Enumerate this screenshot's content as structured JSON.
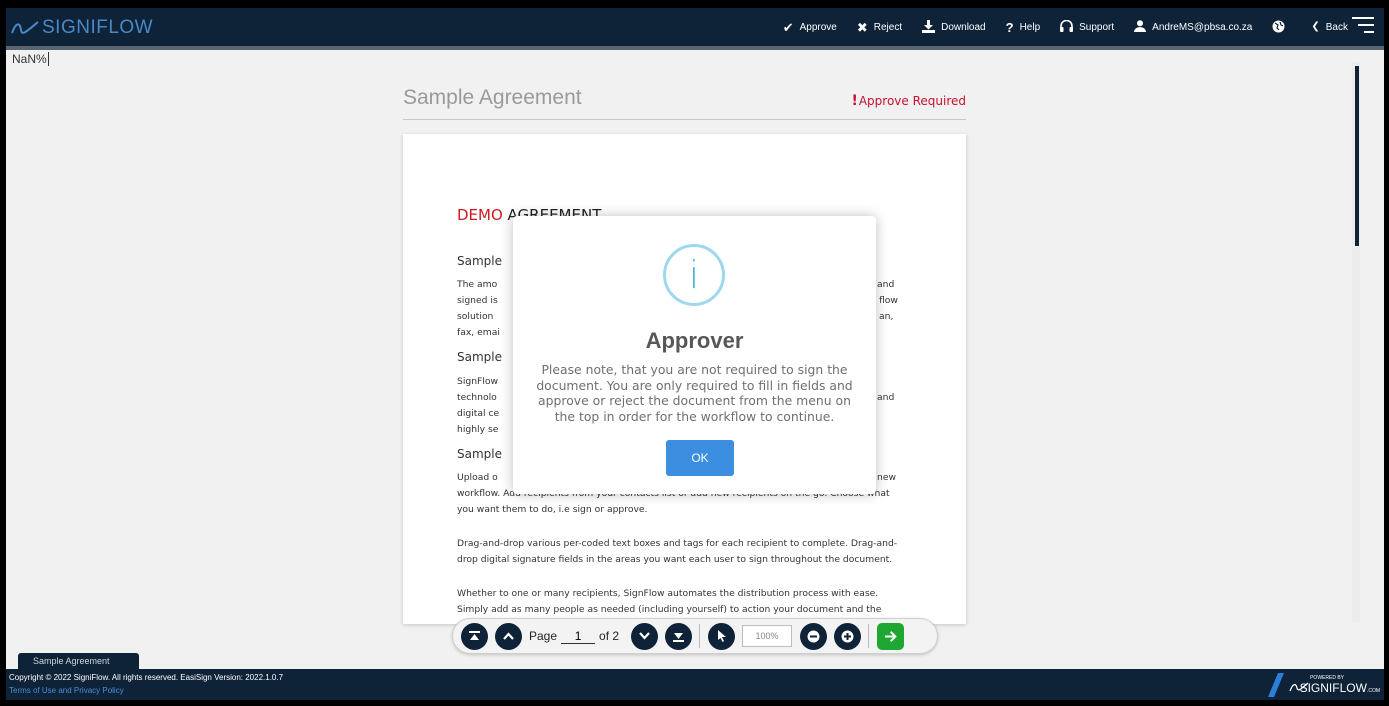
{
  "app": {
    "logo_text": "SIGNIFLOW"
  },
  "topbar": {
    "approve": "Approve",
    "reject": "Reject",
    "download": "Download",
    "help": "Help",
    "support": "Support",
    "user": "AndreMS@pbsa.co.za",
    "back": "Back"
  },
  "progress_text": "NaN%",
  "document": {
    "title": "Sample Agreement",
    "status": "Approve Required",
    "heading_demo": "DEMO",
    "heading_rest": " AGREEMENT",
    "fragments": {
      "sec1": "Sample",
      "p1_l1": "The amo",
      "p1_l2": "signed is",
      "p1_l3": "solution",
      "p1_l4": "fax, emai",
      "p1_r1": "and",
      "p1_r2": "flow",
      "p1_r3": "an,",
      "sec2": "Sample",
      "p2_l1": "SignFlow",
      "p2_l2": "technolo",
      "p2_l3": "digital ce",
      "p2_l4": "highly se",
      "p2_r2": "and",
      "sec3": "Sample",
      "p3_l1": "Upload o",
      "p3_r1": "new"
    },
    "p3_rest": "workflow. Add recipients from your contacts list or add new recipients on the go. Choose what you want them to do, i.e sign or approve.",
    "p4": "Drag-and-drop various per-coded text boxes and tags for each recipient to complete. Drag-and-drop digital signature fields in the areas you want each user to sign throughout the document.",
    "p5": "Whether to one or many recipients, SignFlow automates the distribution process with ease. Simply add as many people as needed (including yourself) to action your document and the"
  },
  "dialog": {
    "icon": "i",
    "title": "Approver",
    "text": "Please note, that you are not required to sign the document. You are only required to fill in fields and approve or reject the document from the menu on the top in order for the workflow to continue.",
    "ok": "OK"
  },
  "toolbar": {
    "page_label": "Page",
    "page_value": "1",
    "page_of": "of 2",
    "zoom": "100%"
  },
  "bottom_tab": "Sample Agreement",
  "footer": {
    "copyright": "Copyright © 2022 SigniFlow. All rights reserved. EasiSign Version: 2022.1.0.7",
    "terms": "Terms of Use and Privacy Policy",
    "powered_by": "POWERED BY",
    "brand": "SIGNIFLOW",
    "brand_suffix": ".COM"
  },
  "colors": {
    "navy": "#0e2238",
    "accent_red": "#c8102e",
    "ok_blue": "#3b8ee0",
    "next_green": "#1ea833",
    "info_icon": "#46b8e2"
  }
}
